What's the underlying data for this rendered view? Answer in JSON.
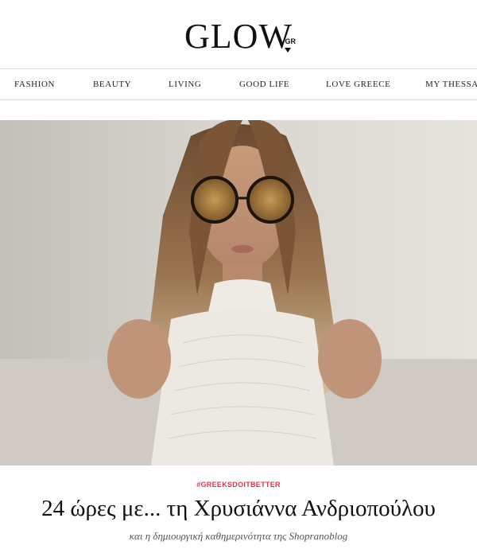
{
  "header": {
    "logo_text": "GLOW",
    "logo_suffix": "GR"
  },
  "nav": {
    "items": [
      {
        "label": "FASHION"
      },
      {
        "label": "BEAUTY"
      },
      {
        "label": "LIVING"
      },
      {
        "label": "GOOD LIFE"
      },
      {
        "label": "LOVE GREECE"
      },
      {
        "label": "MY THESSALONIKI"
      }
    ]
  },
  "article": {
    "tag": "#GREEKSDOITBETTER",
    "title": "24 ώρες με... τη Χρυσιάννα Ανδριοπούλου",
    "subtitle": "και η δημιουργική καθημερινότητα της Shopranoblog"
  },
  "colors": {
    "tag": "#e3344f",
    "divider": "#dcdcdc"
  }
}
